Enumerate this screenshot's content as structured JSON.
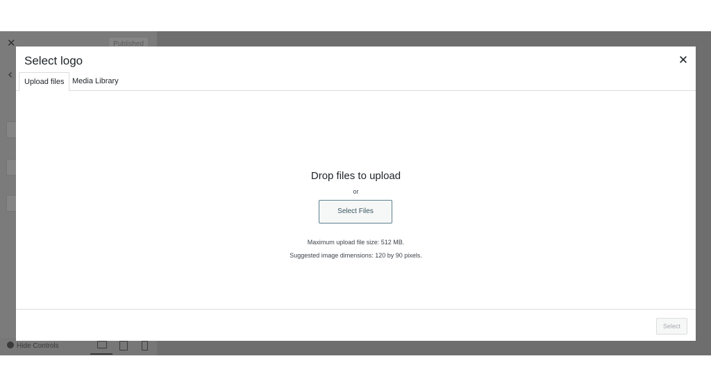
{
  "backdrop": {
    "close_glyph": "✕",
    "published_label": "Published",
    "back_glyph": "‹",
    "hide_controls_label": "Hide Controls"
  },
  "modal": {
    "title": "Select logo",
    "close_glyph": "✕",
    "tabs": [
      {
        "label": "Upload files",
        "active": true
      },
      {
        "label": "Media Library",
        "active": false
      }
    ],
    "upload": {
      "heading": "Drop files to upload",
      "or_text": "or",
      "select_files_label": "Select Files",
      "max_size_text": "Maximum upload file size: 512 MB.",
      "suggested_dimensions_text": "Suggested image dimensions: 120 by 90 pixels."
    },
    "footer": {
      "select_label": "Select",
      "select_disabled": true
    }
  },
  "colors": {
    "overlay": "#6e6e6e",
    "button_border": "#5f7f8f",
    "divider": "#dcdcde"
  }
}
